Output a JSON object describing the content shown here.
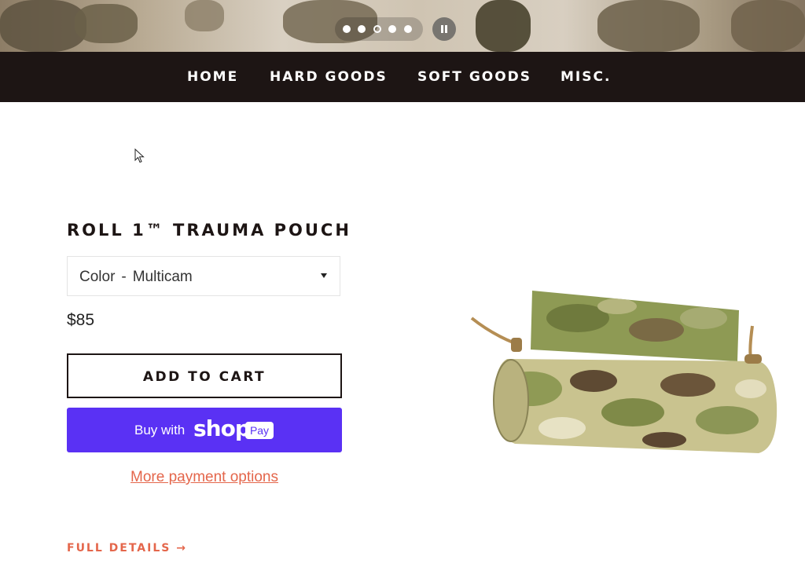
{
  "colors": {
    "nav_bg": "#1d1514",
    "accent": "#e4664b",
    "shop_pay": "#5a31f4",
    "text_dark": "#1d1514"
  },
  "slideshow": {
    "dot_count": 5,
    "active_dot": 3,
    "pause_icon": "pause-icon"
  },
  "nav": {
    "items": [
      {
        "label": "HOME"
      },
      {
        "label": "HARD GOODS"
      },
      {
        "label": "SOFT GOODS"
      },
      {
        "label": "MISC."
      }
    ]
  },
  "product": {
    "title": "ROLL 1™ TRAUMA POUCH",
    "variant": {
      "label": "Color",
      "separator": "-",
      "value": "Multicam"
    },
    "price": "$85",
    "add_to_cart": "ADD TO CART",
    "shop_pay": {
      "prefix": "Buy with",
      "brand": "shop",
      "badge": "Pay"
    },
    "more_payment": "More payment options",
    "full_details": "FULL DETAILS →",
    "image_icon": "camo-trauma-pouch-image"
  }
}
